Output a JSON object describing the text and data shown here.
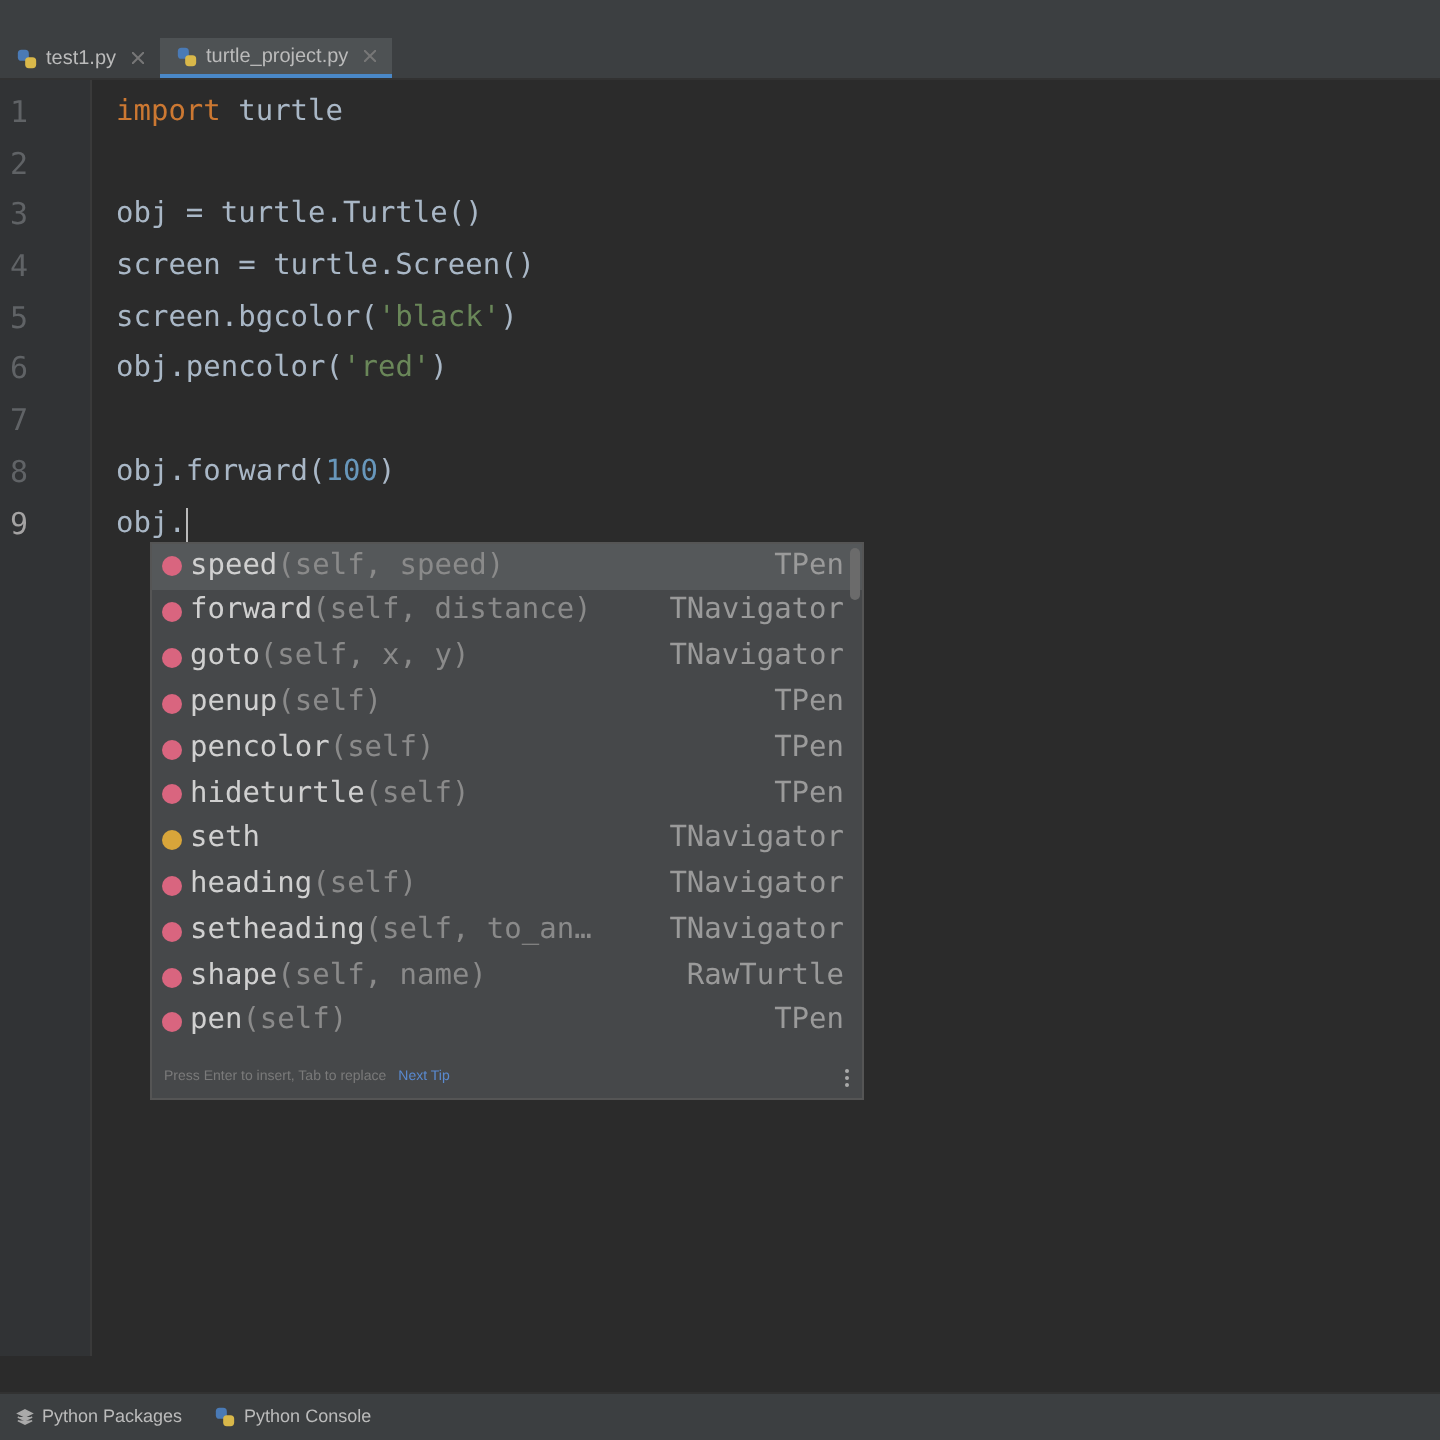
{
  "tabs": [
    {
      "label": "test1.py",
      "selected": false
    },
    {
      "label": "turtle_project.py",
      "selected": true
    }
  ],
  "lines": [
    {
      "number": "1",
      "current": false,
      "tokens": [
        {
          "kind": "keyword",
          "text": "import"
        },
        {
          "kind": "plain",
          "text": " turtle"
        }
      ]
    },
    {
      "number": "2",
      "current": false
    },
    {
      "number": "3",
      "current": false,
      "tokens": [
        {
          "kind": "plain",
          "text": "obj = turtle.Turtle()"
        }
      ]
    },
    {
      "number": "4",
      "current": false,
      "tokens": [
        {
          "kind": "plain",
          "text": "screen = turtle.Screen()"
        }
      ]
    },
    {
      "number": "5",
      "current": false,
      "tokens": [
        {
          "kind": "plain",
          "text": "screen.bgcolor("
        },
        {
          "kind": "string",
          "text": "'black'"
        },
        {
          "kind": "plain",
          "text": ")"
        }
      ]
    },
    {
      "number": "6",
      "current": false,
      "tokens": [
        {
          "kind": "plain",
          "text": "obj.pencolor("
        },
        {
          "kind": "string",
          "text": "'red'"
        },
        {
          "kind": "plain",
          "text": ")"
        }
      ]
    },
    {
      "number": "7",
      "current": false
    },
    {
      "number": "8",
      "current": false,
      "tokens": [
        {
          "kind": "plain",
          "text": "obj.forward("
        },
        {
          "kind": "number",
          "text": "100"
        },
        {
          "kind": "plain",
          "text": ")"
        }
      ]
    },
    {
      "number": "9",
      "current": true,
      "tokens": [
        {
          "kind": "plain",
          "text": "obj."
        }
      ]
    }
  ],
  "completion": {
    "items": [
      {
        "kind": "method",
        "name": "speed",
        "params": "(self, speed)",
        "owner": "TPen",
        "selected": true
      },
      {
        "kind": "method",
        "name": "forward",
        "params": "(self, distance)",
        "owner": "TNavigator",
        "selected": false
      },
      {
        "kind": "method",
        "name": "goto",
        "params": "(self, x, y)",
        "owner": "TNavigator",
        "selected": false
      },
      {
        "kind": "method",
        "name": "penup",
        "params": "(self)",
        "owner": "TPen",
        "selected": false
      },
      {
        "kind": "method",
        "name": "pencolor",
        "params": "(self)",
        "owner": "TPen",
        "selected": false
      },
      {
        "kind": "method",
        "name": "hideturtle",
        "params": "(self)",
        "owner": "TPen",
        "selected": false
      },
      {
        "kind": "field",
        "name": "seth",
        "owner": "TNavigator",
        "selected": false
      },
      {
        "kind": "method",
        "name": "heading",
        "params": "(self)",
        "owner": "TNavigator",
        "selected": false
      },
      {
        "kind": "method",
        "name": "setheading",
        "params": "(self, to_an…",
        "owner": "TNavigator",
        "selected": false
      },
      {
        "kind": "method",
        "name": "shape",
        "params": "(self, name)",
        "owner": "RawTurtle",
        "selected": false
      },
      {
        "kind": "method",
        "name": "pen",
        "params": "(self)",
        "owner": "TPen",
        "selected": false
      }
    ],
    "hint": "Press Enter to insert, Tab to replace",
    "tip_link": "Next Tip"
  },
  "bottom_tools": [
    {
      "kind": "packages",
      "label": "Python Packages"
    },
    {
      "kind": "console",
      "label": "Python Console"
    }
  ]
}
